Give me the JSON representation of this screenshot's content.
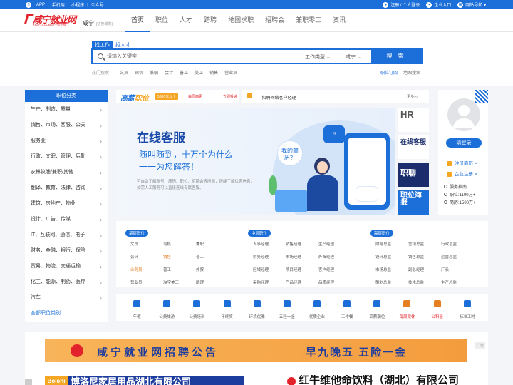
{
  "topbar": {
    "left_items": [
      "APP",
      "手机端",
      "小程序",
      "公众号"
    ],
    "register_login": "注册 / 个人登录",
    "enterprise_entry": "企业入口",
    "site_nav": "网站导航"
  },
  "header": {
    "logo_text": "咸宁就业网",
    "logo_sub": "XNJY15.COM 咸宁就业网",
    "city": "咸宁",
    "city_switch": "[切换城市]",
    "nav": [
      "首页",
      "职位",
      "人才",
      "跨聘",
      "地图求职",
      "招聘会",
      "兼职零工",
      "资讯"
    ]
  },
  "search": {
    "tab_find_job": "找工作",
    "tab_hire": "招人才",
    "placeholder": "请输入关键字",
    "job_type": "工作类型",
    "city": "咸宁",
    "button": "搜 索",
    "hot_label": "热门搜索：",
    "hot_keywords": [
      "文员",
      "司机",
      "兼职",
      "会计",
      "普工",
      "美工",
      "销售",
      "营业员"
    ],
    "job_subscribe": "职位订阅",
    "map_search": "地图搜索"
  },
  "category": {
    "title": "职位分类",
    "items": [
      "生产、制造、质量",
      "销售、市场、客服、公关",
      "服务业",
      "行政、文职、管理、后勤",
      "农林牧渔/兼职/其他",
      "翻译、教育、法律、咨询",
      "建筑、房地产、物业",
      "设计、广告、传媒",
      "IT、互联网、通信、电子",
      "财务、金融、银行、保险",
      "贸易、物流、交通运输",
      "化工、能源、制药、医疗",
      "汽车"
    ],
    "all_label": "全部职位类别"
  },
  "strip": {
    "brand_main": "高薪",
    "brand_sub": "职位",
    "badge1": "5000元以上",
    "badge2": "每周四更",
    "badge3": "立即投递"
  },
  "notice": {
    "text": "· 招聘网络客户经理",
    "more": "更多>>"
  },
  "banner": {
    "title": "在线客服",
    "line1": "随叫随到，十万个为什么",
    "line2": "一一为您解答！",
    "desc": "可自助了解账号、简历、职位、招聘会等问题，还能了解优惠信息，如需人工服务可以直接连线专属客服。",
    "bubble": "我的简历？",
    "help": "?"
  },
  "side_ads": {
    "ad1": "HR",
    "ad2": "在线客服",
    "ad3": "职聊",
    "ad4": "职位海报"
  },
  "user": {
    "login": "请登录",
    "register_resume": "注册简历 >",
    "register_company": "企业注册 >",
    "guide_title": "服务指南",
    "stat1": "职位:1100万+",
    "stat2": "简历:1500万+"
  },
  "jobs": {
    "columns": [
      {
        "tag": "基层职位",
        "items": [
          "文员",
          "司机",
          "兼职",
          "会计",
          "销售",
          "普工",
          "业务员",
          "普工",
          "外贸",
          "营业员",
          "淘宝美工",
          "助理"
        ],
        "highlight": [
          4,
          6
        ]
      },
      {
        "tag": "中层职位",
        "items": [
          "人事经理",
          "销售经理",
          "生产经理",
          "财务经理",
          "市场经理",
          "外贸经理",
          "区域经理",
          "项目经理",
          "客户经理",
          "采购经理",
          "产品经理",
          "品质经理"
        ],
        "highlight": []
      },
      {
        "tag": "高层职位",
        "items": [
          "财务总监",
          "营销总监",
          "行政总监",
          "设计总监",
          "销售总监",
          "运营总监",
          "市场总监",
          "副总经理",
          "厂长",
          "策划总监",
          "技术总监",
          "生产总监"
        ],
        "highlight": []
      }
    ]
  },
  "services": [
    {
      "label": "年假",
      "accent": false
    },
    {
      "label": "公费旅游",
      "accent": false
    },
    {
      "label": "公费培训",
      "accent": false
    },
    {
      "label": "年终奖",
      "accent": false
    },
    {
      "label": "环境优雅",
      "accent": false
    },
    {
      "label": "五险一金",
      "accent": false
    },
    {
      "label": "优质企业",
      "accent": false
    },
    {
      "label": "工作餐",
      "accent": false
    },
    {
      "label": "高薪职位",
      "accent": false
    },
    {
      "label": "每周双休",
      "accent": true
    },
    {
      "label": "公积金",
      "accent": true
    },
    {
      "label": "标准工时",
      "accent": false
    }
  ],
  "announcement": {
    "text1": "咸宁就业网招聘公告",
    "text2": "早九晚五  五险一金",
    "ad_tag": "广告"
  },
  "companies": {
    "company1_logo": "Boloni",
    "company1": "博洛尼家居用品湖北有限公司",
    "company2": "红牛维他命饮料（湖北）有限公司"
  },
  "colors": {
    "primary": "#1c6fd8",
    "accent": "#e3232b",
    "orange": "#f5a623"
  }
}
